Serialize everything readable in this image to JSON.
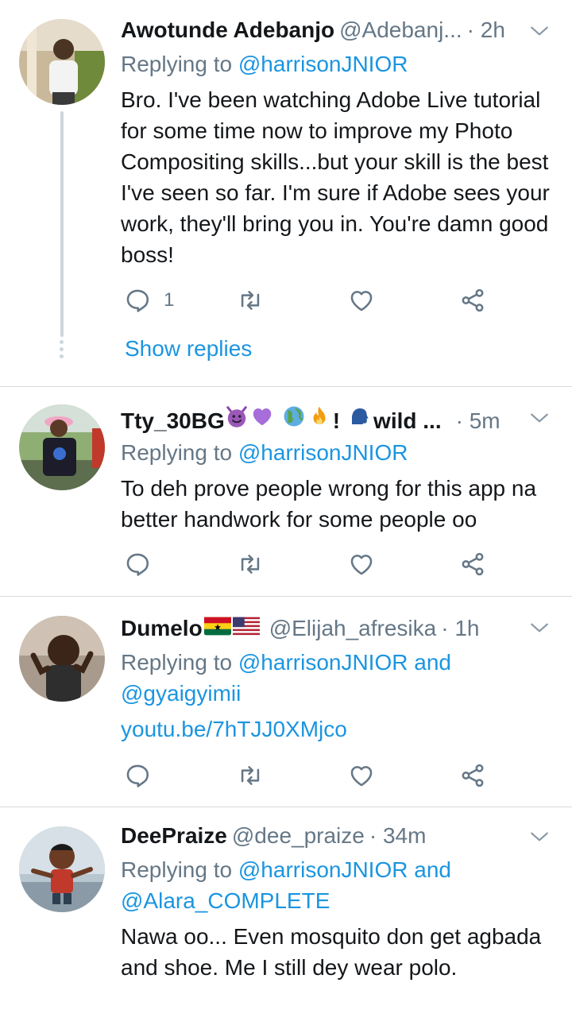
{
  "tweets": [
    {
      "name": "Awotunde Adebanjo",
      "handle": "@Adebanj...",
      "time": "· 2h",
      "replying_label": "Replying to",
      "replying_mentions": "@harrisonJNIOR",
      "body": "Bro. I've been watching Adobe Live tutorial for some time now to improve my Photo Compositing skills...but your skill is the best I've seen so far. I'm sure if Adobe sees your work, they'll bring you in. You're damn good boss!",
      "reply_count": "1",
      "show_replies": "Show replies"
    },
    {
      "name": "Tty_30BG",
      "name_suffix": "!",
      "name_tail": "wild ...",
      "time": "· 5m",
      "replying_label": "Replying to",
      "replying_mentions": "@harrisonJNIOR",
      "body": "To deh prove people wrong for this app na better handwork for some people oo"
    },
    {
      "name": "Dumelo",
      "handle": "@Elijah_afresika",
      "time": "· 1h",
      "replying_label": "Replying to",
      "replying_mentions_1": "@harrisonJNIOR",
      "replying_and": "and",
      "replying_mentions_2": "@gyaigyimii",
      "link": "youtu.be/7hTJJ0XMjco"
    },
    {
      "name": "DeePraize",
      "handle": "@dee_praize",
      "time": "· 34m",
      "replying_label": "Replying to",
      "replying_mentions_1": "@harrisonJNIOR",
      "replying_and": "and",
      "replying_mentions_2": "@Alara_COMPLETE",
      "body": "Nawa oo... Even mosquito don get agbada and shoe. Me I still dey wear polo."
    }
  ],
  "colors": {
    "accent": "#1b95e0",
    "muted": "#657786",
    "text": "#14171a",
    "divider": "#d6dbdf"
  }
}
